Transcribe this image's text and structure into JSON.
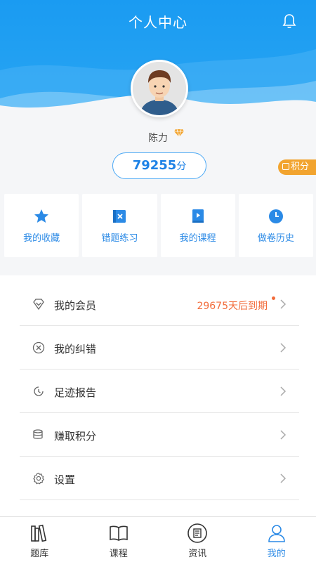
{
  "header": {
    "title": "个人中心"
  },
  "profile": {
    "name": "陈力",
    "points_value": "79255",
    "points_unit": "分",
    "jifen_tag": "积分"
  },
  "quick_links": [
    {
      "label": "我的收藏",
      "icon": "star-icon"
    },
    {
      "label": "错题练习",
      "icon": "wrong-question-icon"
    },
    {
      "label": "我的课程",
      "icon": "course-play-icon"
    },
    {
      "label": "做卷历史",
      "icon": "clock-icon"
    }
  ],
  "menu": [
    {
      "label": "我的会员",
      "icon": "vip-diamond-icon",
      "extra": "29675天后到期"
    },
    {
      "label": "我的纠错",
      "icon": "correction-icon"
    },
    {
      "label": "足迹报告",
      "icon": "footprint-icon"
    },
    {
      "label": "赚取积分",
      "icon": "coins-icon"
    },
    {
      "label": "设置",
      "icon": "gear-icon"
    }
  ],
  "tabs": [
    {
      "label": "题库",
      "icon": "books-icon"
    },
    {
      "label": "课程",
      "icon": "open-book-icon"
    },
    {
      "label": "资讯",
      "icon": "news-icon"
    },
    {
      "label": "我的",
      "icon": "user-icon",
      "active": true
    }
  ],
  "colors": {
    "accent": "#2b8ae6",
    "header": "#1a9bf2",
    "warning": "#f26b3a",
    "tag": "#f2a42f"
  }
}
